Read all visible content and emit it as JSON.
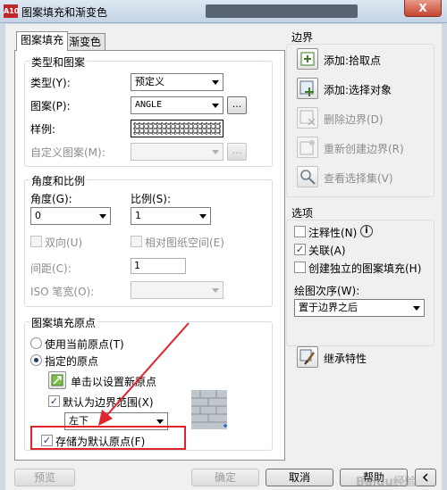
{
  "window": {
    "title": "图案填充和渐变色",
    "app_logo": "A10",
    "close_label": "X"
  },
  "tabs": {
    "hatch": "图案填充",
    "gradient": "渐变色"
  },
  "type_pattern": {
    "title": "类型和图案",
    "type_label": "类型(Y):",
    "type_value": "预定义",
    "pattern_label": "图案(P):",
    "pattern_value": "ANGLE",
    "pattern_browse": "...",
    "sample_label": "样例:",
    "custom_label": "自定义图案(M):",
    "custom_browse": "..."
  },
  "angle_scale": {
    "title": "角度和比例",
    "angle_label": "角度(G):",
    "angle_value": "0",
    "scale_label": "比例(S):",
    "scale_value": "1",
    "double_label": "双向(U)",
    "relative_label": "相对图纸空间(E)",
    "spacing_label": "间距(C):",
    "spacing_value": "1",
    "iso_label": "ISO 笔宽(O):"
  },
  "origin": {
    "title": "图案填充原点",
    "use_current": "使用当前原点(T)",
    "specified": "指定的原点",
    "click_set": "单击以设置新原点",
    "default_extents": "默认为边界范围(X)",
    "extents_value": "左下",
    "store_default": "存储为默认原点(F)"
  },
  "boundary": {
    "title": "边界",
    "add_pick": "添加:拾取点",
    "add_select": "添加:选择对象",
    "remove": "删除边界(D)",
    "recreate": "重新创建边界(R)",
    "view_selection": "查看选择集(V)"
  },
  "options": {
    "title": "选项",
    "annotative": "注释性(N)",
    "info_icon": "i",
    "associative": "关联(A)",
    "independent": "创建独立的图案填充(H)",
    "draw_order_label": "绘图次序(W):",
    "draw_order_value": "置于边界之后"
  },
  "inherit": "继承特性",
  "footer": {
    "preview": "预览",
    "ok": "确定",
    "cancel": "取消",
    "help": "帮助"
  },
  "watermark": "Baidu经验",
  "colors": {
    "annotation_red": "#e0242c",
    "accent_blue": "#1d3a6a"
  }
}
